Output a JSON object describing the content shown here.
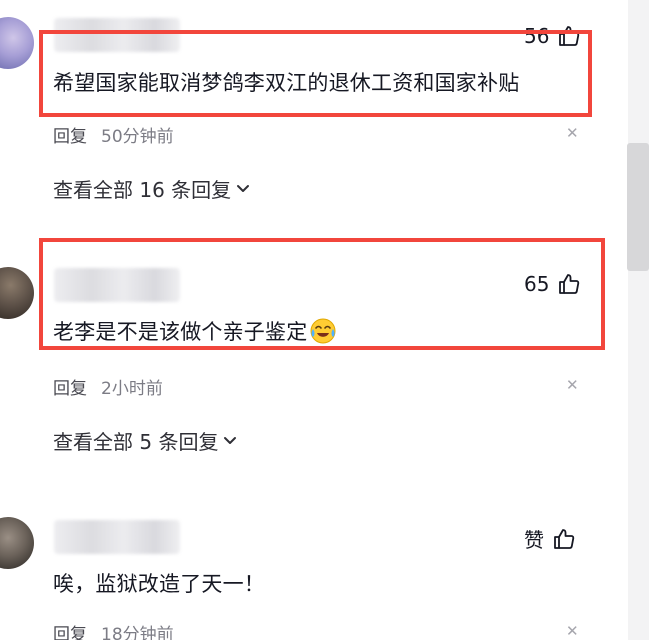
{
  "comments": [
    {
      "likes": "56",
      "text": "希望国家能取消梦鸽李双江的退休工资和国家补贴",
      "reply_label": "回复",
      "time": "50分钟前",
      "view_replies": "查看全部 16 条回复"
    },
    {
      "likes": "65",
      "text": "老李是不是该做个亲子鉴定",
      "reply_label": "回复",
      "time": "2小时前",
      "view_replies": "查看全部 5 条回复"
    },
    {
      "likes": "赞",
      "text": "唉，监狱改造了天一！",
      "reply_label": "回复",
      "time": "18分钟前"
    }
  ],
  "icons": {
    "like": "thumbs-up-icon",
    "dismiss": "close-icon",
    "expand": "chevron-down-icon",
    "emoji": "crying-laughing-emoji"
  },
  "colors": {
    "highlight": "#f2463c",
    "meta_text": "#7c7c85",
    "body_text": "#161823"
  }
}
